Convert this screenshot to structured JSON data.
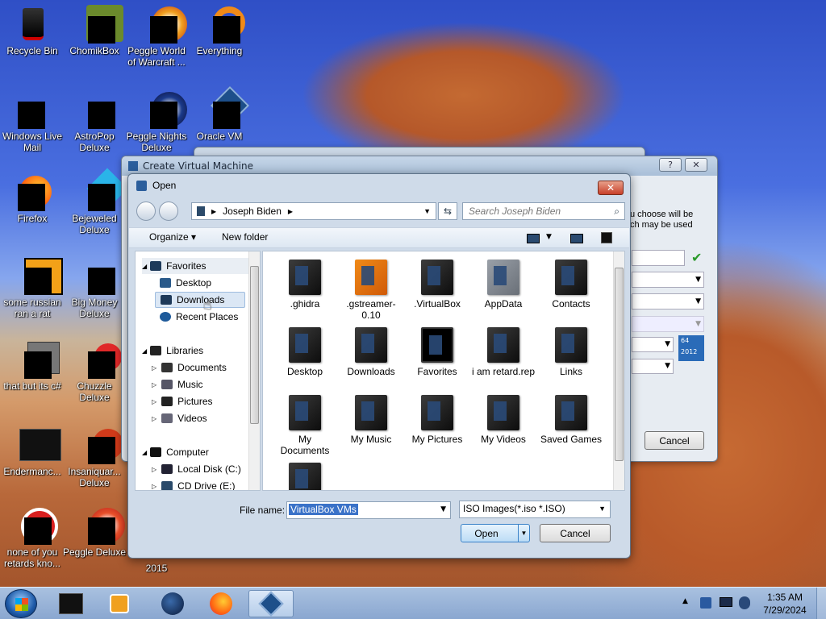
{
  "desktop": {
    "icons": [
      {
        "label": "Recycle Bin"
      },
      {
        "label": "ChomikBox"
      },
      {
        "label": "Peggle World of Warcraft ..."
      },
      {
        "label": "Everything"
      },
      {
        "label": "Windows Live Mail"
      },
      {
        "label": "AstroPop Deluxe"
      },
      {
        "label": "Peggle Nights Deluxe"
      },
      {
        "label": "Oracle VM"
      },
      {
        "label": "Firefox"
      },
      {
        "label": "Bejeweled Deluxe"
      },
      {
        "label": "some russian ran a rat"
      },
      {
        "label": "Big Money Deluxe"
      },
      {
        "label": "that but its c#"
      },
      {
        "label": "Chuzzle Deluxe"
      },
      {
        "label": "Endermanc..."
      },
      {
        "label": "Insaniquar... Deluxe"
      },
      {
        "label": "none of you retards kno..."
      },
      {
        "label": "Peggle Deluxe"
      },
      {
        "label": "2015"
      }
    ]
  },
  "create_vm": {
    "title": "Create Virtual Machine",
    "help": "?",
    "close": "✕",
    "text": "u choose will be\nch may be used",
    "cancel": "Cancel",
    "badge": "64\n2012"
  },
  "open_dialog": {
    "title": "Open",
    "close": "✕",
    "path": "Joseph Biden",
    "search_placeholder": "Search Joseph Biden",
    "organize": "Organize ▾",
    "new_folder": "New folder",
    "nav": {
      "favorites": "Favorites",
      "desktop": "Desktop",
      "downloads": "Downloads",
      "recent": "Recent Places",
      "libraries": "Libraries",
      "documents": "Documents",
      "music": "Music",
      "pictures": "Pictures",
      "videos": "Videos",
      "computer": "Computer",
      "local_disk": "Local Disk (C:)",
      "cd_drive": "CD Drive (E:)"
    },
    "files": [
      ".ghidra",
      ".gstreamer-0.10",
      ".VirtualBox",
      "AppData",
      "Contacts",
      "Desktop",
      "Downloads",
      "Favorites",
      "i am retard.rep",
      "Links",
      "My Documents",
      "My Music",
      "My Pictures",
      "My Videos",
      "Saved Games"
    ],
    "filename_label": "File name:",
    "filename_value": "VirtualBox VMs",
    "filter": "ISO Images(*.iso *.ISO)",
    "open": "Open",
    "cancel": "Cancel"
  },
  "taskbar": {
    "time": "1:35 AM",
    "date": "7/29/2024"
  }
}
